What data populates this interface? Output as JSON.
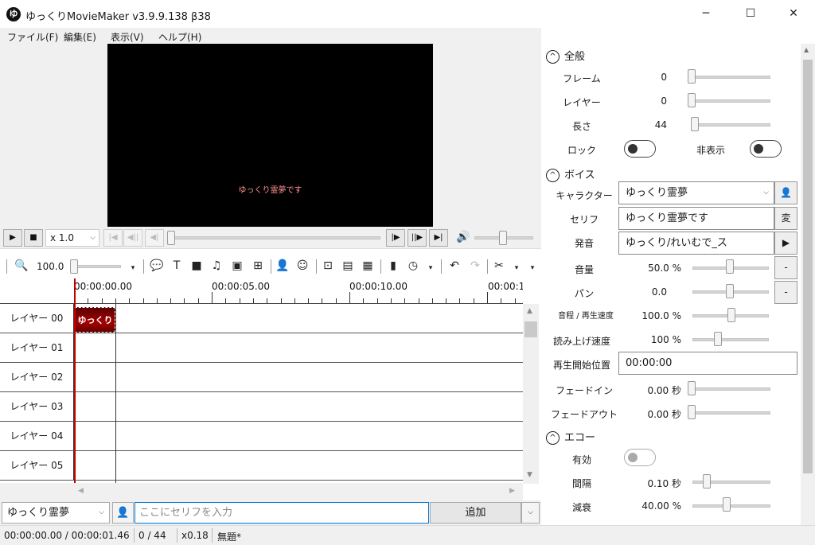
{
  "window": {
    "icon_glyph": "ゆ",
    "title": "ゆっくりMovieMaker v3.9.9.138 β38",
    "minimize": "─",
    "maximize": "☐",
    "close": "✕"
  },
  "menu": [
    "ファイル(F)",
    "編集(E)",
    "表示(V)",
    "ヘルプ(H)"
  ],
  "preview": {
    "caption": "ゆっくり霊夢です"
  },
  "transport": {
    "speed": "x 1.0",
    "play": "▶",
    "stop": "■"
  },
  "toolbar": {
    "zoom": "100.0"
  },
  "timeline": {
    "ticks": [
      "00:00:00.00",
      "00:00:05.00",
      "00:00:10.00",
      "00:00:1"
    ],
    "layers": [
      "レイヤー 00",
      "レイヤー 01",
      "レイヤー 02",
      "レイヤー 03",
      "レイヤー 04",
      "レイヤー 05"
    ],
    "clip_label": "ゆっくり"
  },
  "bottom": {
    "character": "ゆっくり霊夢",
    "serif_placeholder": "ここにセリフを入力",
    "add": "追加"
  },
  "status": {
    "time": "00:00:00.00  /  00:00:01.46",
    "frames": "0  /  44",
    "zoom": "x0.18",
    "file": "無題*"
  },
  "panel": {
    "general": {
      "heading": "全般",
      "frame_label": "フレーム",
      "frame_val": "0",
      "layer_label": "レイヤー",
      "layer_val": "0",
      "length_label": "長さ",
      "length_val": "44",
      "lock_label": "ロック",
      "hide_label": "非表示"
    },
    "voice": {
      "heading": "ボイス",
      "character_label": "キャラクター",
      "character_val": "ゆっくり霊夢",
      "serif_label": "セリフ",
      "serif_val": "ゆっくり霊夢です",
      "serif_btn": "変",
      "pron_label": "発音",
      "pron_val": "ゆっくり/れいむで_ス",
      "pron_btn": "▶",
      "volume_label": "音量",
      "volume_val": "50.0 %",
      "minus": "-",
      "pan_label": "パン",
      "pan_val": "0.0",
      "pitch_label": "音程 / 再生速度",
      "pitch_val": "100.0 %",
      "readspeed_label": "読み上げ速度",
      "readspeed_val": "100 %",
      "start_label": "再生開始位置",
      "start_val": "00:00:00",
      "fadein_label": "フェードイン",
      "fadein_val": "0.00 秒",
      "fadeout_label": "フェードアウト",
      "fadeout_val": "0.00 秒"
    },
    "echo": {
      "heading": "エコー",
      "enabled_label": "有効",
      "interval_label": "間隔",
      "interval_val": "0.10 秒",
      "decay_label": "減衰",
      "decay_val": "40.00 %"
    }
  }
}
